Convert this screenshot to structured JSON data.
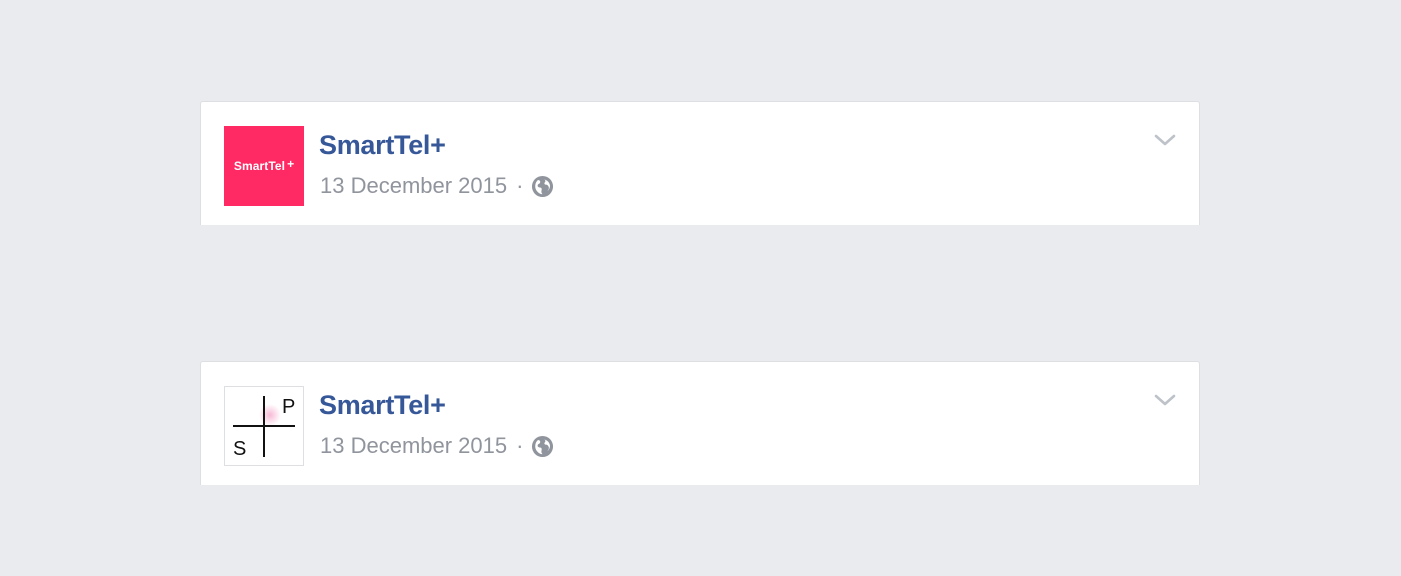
{
  "posts": [
    {
      "page_name": "SmartTel+",
      "date": "13 December 2015",
      "separator": "·",
      "privacy_icon": "globe-icon",
      "menu_icon": "chevron-down-icon",
      "avatar": {
        "style": "logo",
        "text": "SmartTel",
        "plus": "+",
        "background": "#ff2a64"
      }
    },
    {
      "page_name": "SmartTel+",
      "date": "13 December 2015",
      "separator": "·",
      "privacy_icon": "globe-icon",
      "menu_icon": "chevron-down-icon",
      "avatar": {
        "style": "quadrant-cross",
        "label_top_right": "P",
        "label_bottom_left": "S",
        "accent": "#f9c8de"
      }
    }
  ],
  "colors": {
    "background": "#e9ebee",
    "card": "#ffffff",
    "name": "#365899",
    "meta": "#90949c"
  }
}
